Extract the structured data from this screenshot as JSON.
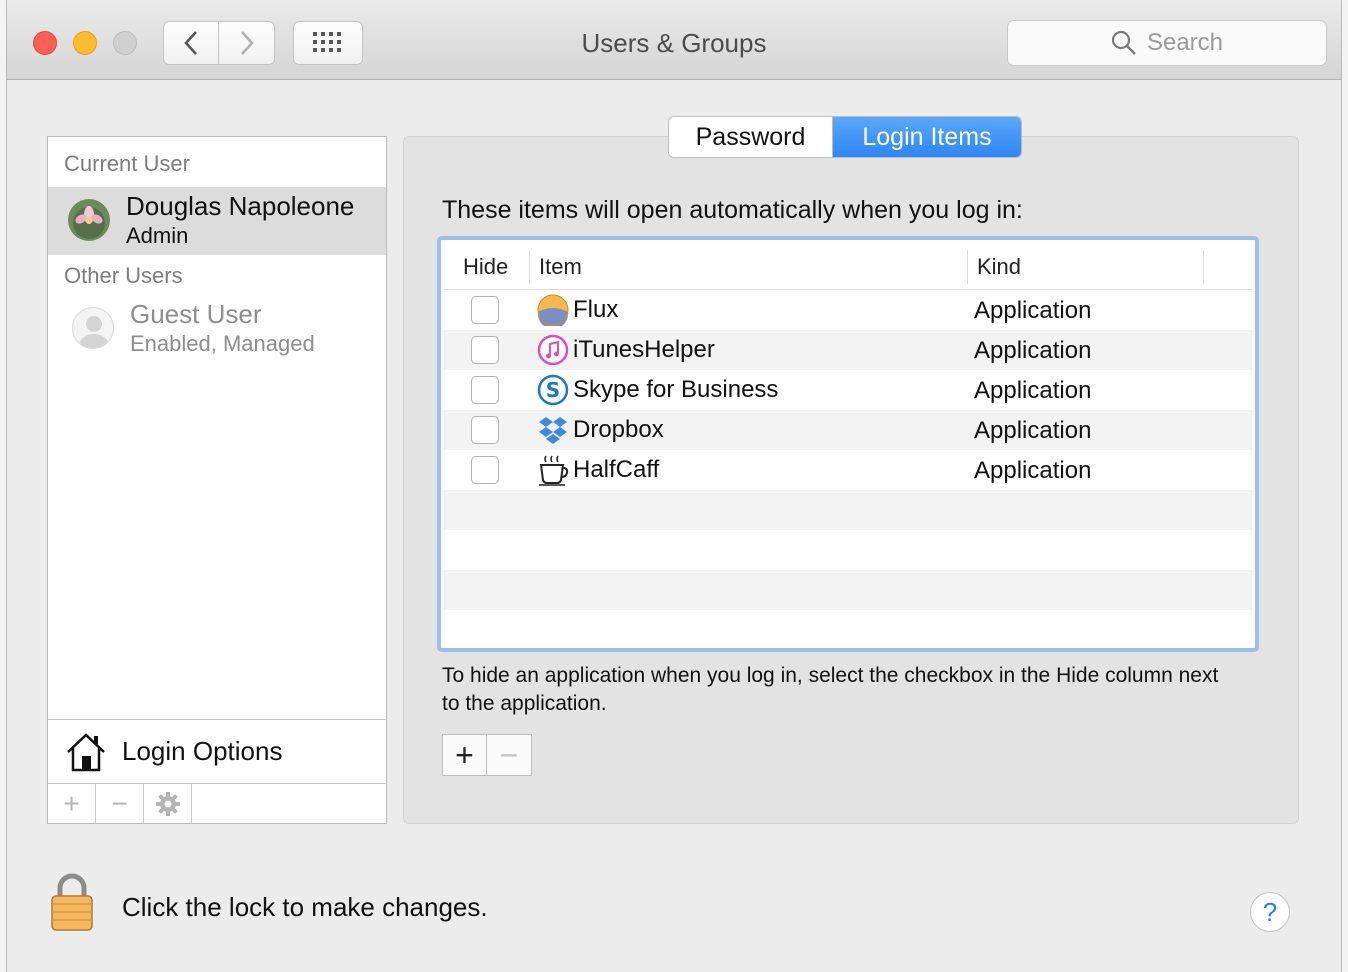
{
  "window": {
    "title": "Users & Groups"
  },
  "search": {
    "placeholder": "Search"
  },
  "sidebar": {
    "current_user_header": "Current User",
    "current_user": {
      "name": "Douglas Napoleone",
      "role": "Admin"
    },
    "other_users_header": "Other Users",
    "guest": {
      "name": "Guest User",
      "status": "Enabled, Managed"
    },
    "login_options_label": "Login Options",
    "toolbar": {
      "add": "+",
      "remove": "−",
      "settings_icon": "gear-icon"
    }
  },
  "tabs": [
    {
      "label": "Password",
      "selected": false
    },
    {
      "label": "Login Items",
      "selected": true
    }
  ],
  "login_items": {
    "intro": "These items will open automatically when you log in:",
    "columns": {
      "hide": "Hide",
      "item": "Item",
      "kind": "Kind"
    },
    "rows": [
      {
        "name": "Flux",
        "kind": "Application",
        "icon": "flux-icon",
        "hide": false
      },
      {
        "name": "iTunesHelper",
        "kind": "Application",
        "icon": "itunes-icon",
        "hide": false
      },
      {
        "name": "Skype for Business",
        "kind": "Application",
        "icon": "skype-icon",
        "hide": false
      },
      {
        "name": "Dropbox",
        "kind": "Application",
        "icon": "dropbox-icon",
        "hide": false
      },
      {
        "name": "HalfCaff",
        "kind": "Application",
        "icon": "coffee-cup-icon",
        "hide": false
      }
    ],
    "hint": "To hide an application when you log in, select the checkbox in the Hide column next to the application.",
    "add_label": "+",
    "remove_label": "−"
  },
  "footer": {
    "lock_text": "Click the lock to make changes.",
    "help_label": "?"
  },
  "colors": {
    "accent": "#2f86f5",
    "table_focus": "#9dbfea",
    "close": "#fc5f57",
    "minimize": "#fdbc2e"
  }
}
